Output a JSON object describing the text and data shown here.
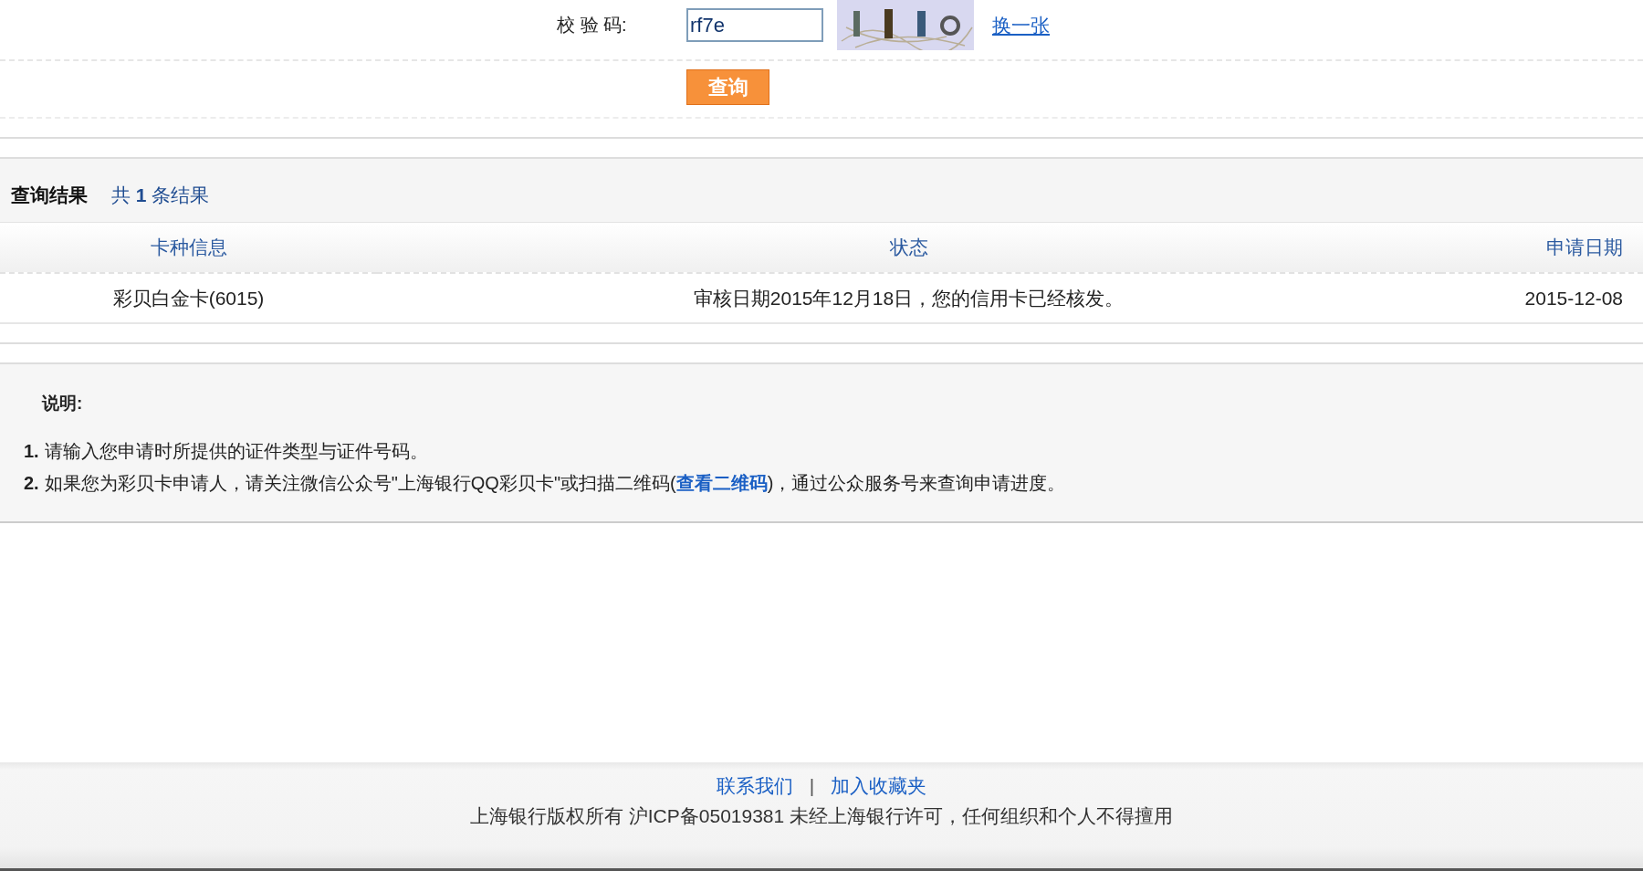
{
  "verify_form": {
    "label": "校 验 码:",
    "code_field": {
      "value": "rf7e"
    },
    "refresh_link": "换一张",
    "submit_button": "查询"
  },
  "results": {
    "title": "查询结果",
    "count_prefix": "共",
    "count": "1",
    "count_suffix": "条结果",
    "columns": [
      "卡种信息",
      "状态",
      "申请日期"
    ],
    "rows": [
      {
        "card": "彩贝白金卡(6015)",
        "status": "审核日期2015年12月18日，您的信用卡已经核发。",
        "date": "2015-12-08"
      }
    ]
  },
  "notes": {
    "title": "说明:",
    "items": [
      {
        "number": "1.",
        "text": "请输入您申请时所提供的证件类型与证件号码。"
      },
      {
        "number": "2.",
        "text": "如果您为彩贝卡申请人，请关注微信公众号\"上海银行QQ彩贝卡\"或扫描二维码(",
        "link": "查看二维码",
        "text_after": ")，通过公众服务号来查询申请进度。"
      }
    ]
  },
  "footer": {
    "links": [
      "联系我们",
      "加入收藏夹"
    ],
    "separator": "|",
    "copyright": "上海银行版权所有 沪ICP备05019381 未经上海银行许可，任何组织和个人不得擅用"
  }
}
